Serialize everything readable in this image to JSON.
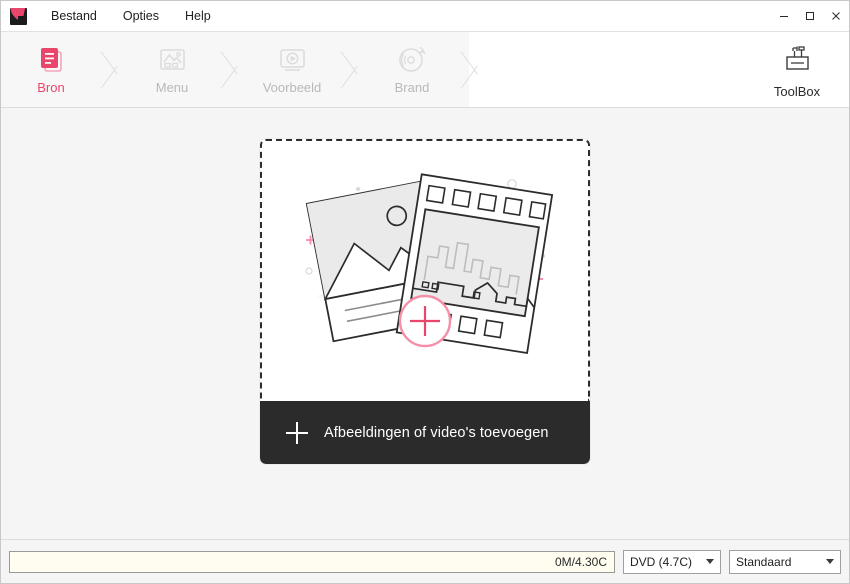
{
  "window": {
    "app_icon": "app-logo-icon",
    "controls": {
      "minimize": "minimize-icon",
      "maximize": "maximize-icon",
      "close": "close-icon"
    }
  },
  "menubar": {
    "items": [
      {
        "label": "Bestand"
      },
      {
        "label": "Opties"
      },
      {
        "label": "Help"
      }
    ]
  },
  "navbar": {
    "steps": [
      {
        "label": "Bron",
        "icon": "document-stack-icon",
        "active": true
      },
      {
        "label": "Menu",
        "icon": "image-frame-icon",
        "active": false
      },
      {
        "label": "Voorbeeld",
        "icon": "monitor-play-icon",
        "active": false
      },
      {
        "label": "Brand",
        "icon": "burn-disc-icon",
        "active": false
      }
    ],
    "toolbox": {
      "label": "ToolBox",
      "icon": "toolbox-icon"
    },
    "accent_color": "#e8476b",
    "inactive_color": "#b9b9b9"
  },
  "main": {
    "dropzone": {
      "illustration": "photo-and-filmstrip-illustration",
      "add_icon": "plus-circle-icon",
      "footer_plus_icon": "plus-icon",
      "footer_label": "Afbeeldingen of video's toevoegen"
    }
  },
  "bottombar": {
    "capacity_text": "0M/4.30C",
    "disc_select": {
      "value": "DVD (4.7C)",
      "arrow_icon": "chevron-down-icon"
    },
    "quality_select": {
      "value": "Standaard",
      "arrow_icon": "chevron-down-icon"
    }
  }
}
